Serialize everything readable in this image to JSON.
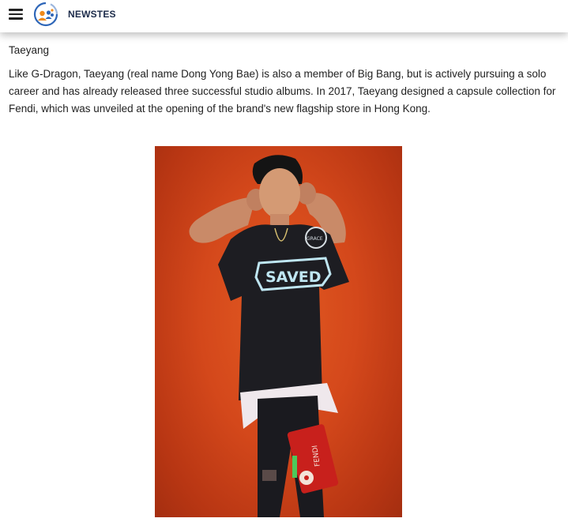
{
  "header": {
    "brand": "NEWSTES",
    "menu_icon": "hamburger-menu-icon",
    "logo_icon": "people-logo-icon"
  },
  "article": {
    "subject": "Taeyang",
    "paragraph": "Like G-Dragon, Taeyang (real name Dong Yong Bae) is also a member of Big Bang, but is actively pursuing a solo career and has already released three successful studio albums. In 2017, Taeyang designed a capsule collection for Fendi, which was unveiled at the opening of the brand's new flagship store in Hong Kong.",
    "photo": {
      "tshirt_text": "SAVED",
      "badge_text": "GRACE",
      "bag_text": "FENDI"
    }
  },
  "colors": {
    "photo_background": "#d4481b",
    "brand_text": "#1c2b4a",
    "logo_blue": "#2e66b8",
    "logo_orange": "#f08a1c"
  }
}
